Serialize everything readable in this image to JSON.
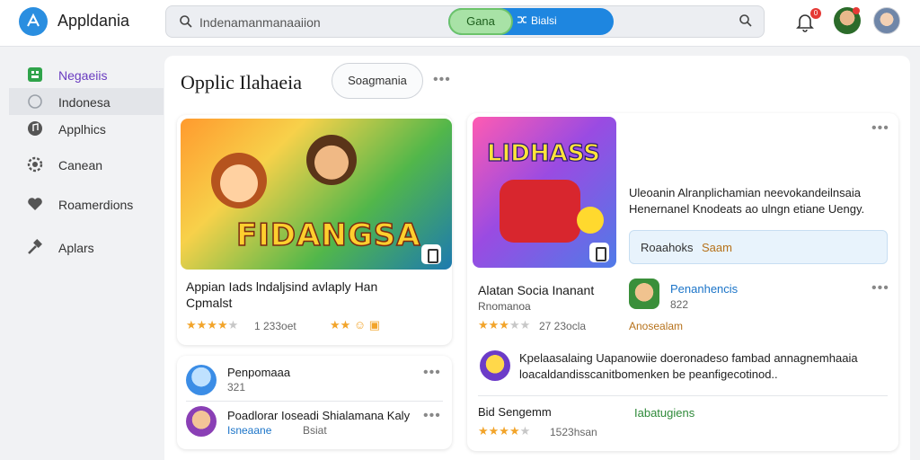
{
  "app": {
    "title": "Appldania"
  },
  "search": {
    "query": "Indenamanmanaaiion",
    "toggle_left": "Gana",
    "toggle_right": "Bialsi"
  },
  "notifications": {
    "badge": "0"
  },
  "sidebar": {
    "items": [
      {
        "label": "Negaeiis",
        "icon": "grid-icon"
      },
      {
        "label": "Indonesa",
        "icon": "circle-icon"
      },
      {
        "label": "Applhics",
        "icon": "music-icon"
      },
      {
        "label": "Canean",
        "icon": "gear-icon"
      },
      {
        "label": "Roamerdions",
        "icon": "heart-icon"
      },
      {
        "label": "Aplars",
        "icon": "hammer-icon"
      }
    ]
  },
  "main": {
    "section_title": "Opplic Ilahaeia",
    "filter_chip": "Soagmania",
    "card_a": {
      "game_logo": "FIDANGSA",
      "title_line1": "Appian Iads lndaljsind avlaply Han",
      "title_line2": "Cpmalst",
      "rating_count": "1 233oet",
      "stars_full": 4,
      "stars_total": 5
    },
    "card_b": {
      "game_logo": "LIDHASS",
      "title": "Alatan Socia Inanant",
      "subtitle": "Rnomanoa",
      "rating_count": "27 23ocla",
      "stars_full": 3,
      "stars_total": 5,
      "desc_line1": "Uleoanin Alranplichamian neevokandeilnsaia",
      "desc_line2": "Henernanel Knodeats ao ulngn etiane Uengy.",
      "action_left": "Roaahoks",
      "action_right": "Saam",
      "dev_name": "Penanhencis",
      "dev_meta": "822",
      "dev_tag": "Anosealam",
      "review_line1": "Kpelaasalaing Uapanowiie doeronadeso fambad annagnemhaaia",
      "review_line2": "loacaldandisscanitbomenken be peanfigecotinod..",
      "footer_left": "Bid Sengemm",
      "footer_right": "Iabatugiens",
      "footer_count": "1523hsan",
      "footer_stars_full": 4,
      "footer_stars_total": 5
    },
    "list": [
      {
        "name": "Penpomaaa",
        "meta": "321"
      },
      {
        "name": "Poadlorar Ioseadi Shialamana Kaly",
        "meta_blue": "Isneaane",
        "meta_gray": "Bsiat"
      }
    ]
  },
  "colors": {
    "accent": "#1e86e0",
    "green": "#2f8a3a",
    "star": "#f2a42a"
  }
}
